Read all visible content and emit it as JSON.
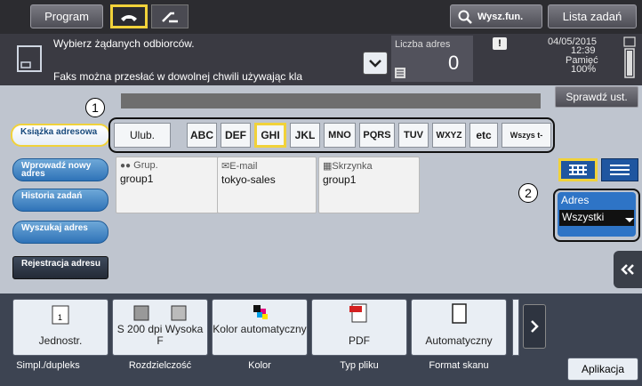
{
  "topbar": {
    "program_label": "Program",
    "search_label": "Wysz.fun.",
    "jobs_label": "Lista zadań"
  },
  "info": {
    "line1": "Wybierz żądanych odbiorców.",
    "line2": "Faks można przesłać w dowolnej chwili używając kla",
    "count_label": "Liczba adres",
    "count_value": "0",
    "date": "04/05/2015",
    "time": "12:39",
    "memory_label": "Pamięć",
    "memory_value": "100%"
  },
  "check_button": "Sprawdź ust.",
  "callouts": [
    "1",
    "2"
  ],
  "sidebar": [
    {
      "label": "Książka adresowa"
    },
    {
      "label": "Wprowadź nowy adres"
    },
    {
      "label": "Historia zadań"
    },
    {
      "label": "Wyszukaj adres"
    },
    {
      "label": "Rejestracja adresu"
    }
  ],
  "index_tabs": [
    "Ulub.",
    "ABC",
    "DEF",
    "GHI",
    "JKL",
    "MNO",
    "PQRS",
    "TUV",
    "WXYZ",
    "etc",
    "Wszys t-"
  ],
  "selected_index": "GHI",
  "cards": [
    {
      "type": "Grup.",
      "value": "group1"
    },
    {
      "type": "E-mail",
      "value": "tokyo-sales"
    },
    {
      "type": "Skrzynka",
      "value": "group1"
    }
  ],
  "address_filter": {
    "label": "Adres",
    "value": "Wszystki"
  },
  "functions": [
    {
      "value": "Jednostr.",
      "label": "Simpl./dupleks"
    },
    {
      "value": "S 200 dpi Wysoka F",
      "label": "Rozdzielczość"
    },
    {
      "value": "Kolor automatyczny",
      "label": "Kolor"
    },
    {
      "value": "PDF",
      "label": "Typ pliku"
    },
    {
      "value": "Automatyczny",
      "label": "Format skanu"
    }
  ],
  "apps_button": "Aplikacja",
  "colors": {
    "accent_yellow": "#f1d23a",
    "pill_blue": "#2f73b8",
    "top_dark": "#2c2c30"
  }
}
